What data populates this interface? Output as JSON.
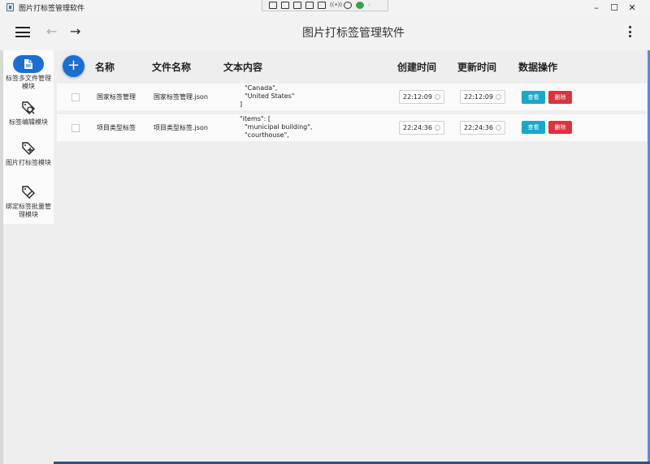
{
  "window": {
    "title": "图片打标签管理软件",
    "min_label": "–",
    "max_label": "☐",
    "close_label": "✕"
  },
  "appbar": {
    "title": "图片打标签管理软件",
    "back_label": "←",
    "forward_label": "→"
  },
  "toolbar": {
    "audio_label": "((•))"
  },
  "sidebar": {
    "items": [
      {
        "label": "标签多文件管理模块",
        "icon": "document-icon",
        "active": true
      },
      {
        "label": "标签编辑模块",
        "icon": "tag-search-icon",
        "active": false
      },
      {
        "label": "图片打标签模块",
        "icon": "tag-plus-icon",
        "active": false
      },
      {
        "label": "绑定标签批量管理模块",
        "icon": "tag-edit-icon",
        "active": false
      }
    ]
  },
  "table": {
    "add_label": "+",
    "headers": {
      "name": "名称",
      "filename": "文件名称",
      "content": "文本内容",
      "created": "创建时间",
      "updated": "更新时间",
      "actions": "数据操作"
    },
    "view_label": "查看",
    "delete_label": "删除",
    "rows": [
      {
        "name": "国家标签管理",
        "filename": "国家标签管理.json",
        "content": [
          "\"Canada\",",
          "\"United States\"",
          "]"
        ],
        "created": "22:12:09",
        "updated": "22:12:09"
      },
      {
        "name": "项目类型标签",
        "filename": "项目类型标签.json",
        "content": [
          "\"items\": [",
          "\"municipal building\",",
          "\"courthouse\","
        ],
        "created": "22:24:36",
        "updated": "22:24:36"
      }
    ]
  },
  "colors": {
    "primary": "#1a6fd1",
    "view": "#17a9c6",
    "delete": "#d9343f"
  }
}
